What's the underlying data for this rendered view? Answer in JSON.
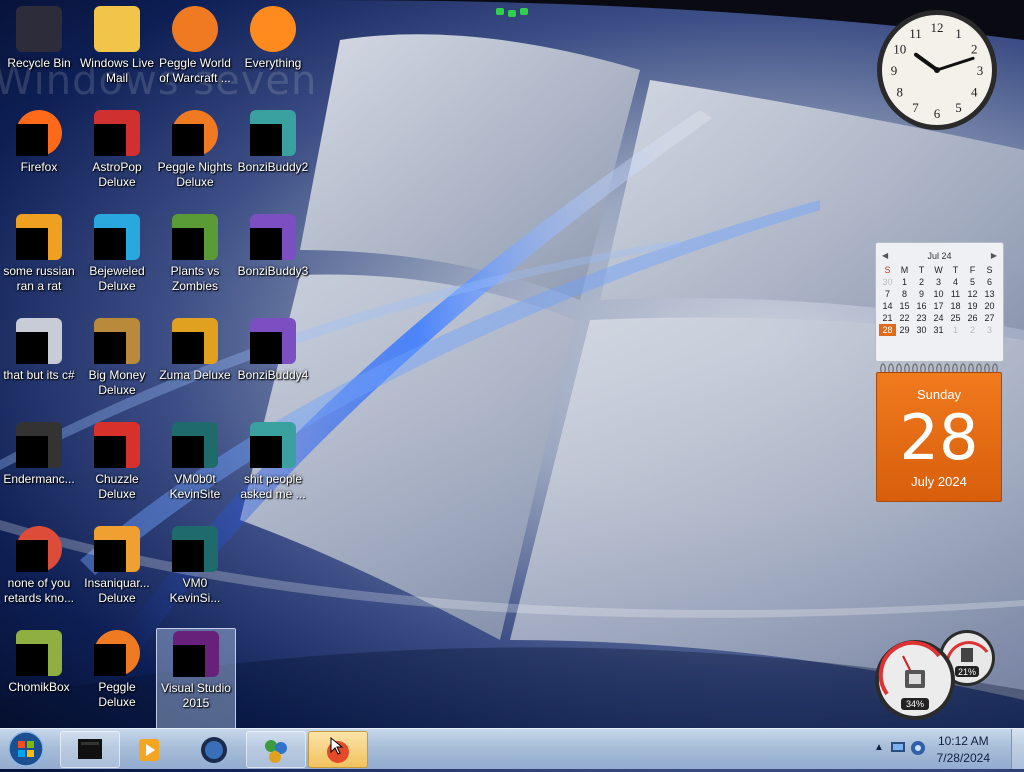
{
  "watermark": "Windows seven",
  "desktop_icons": [
    {
      "label": "Recycle Bin",
      "icon": "recycle-bin-icon"
    },
    {
      "label": "Windows Live Mail",
      "icon": "mail-icon"
    },
    {
      "label": "Peggle World of Warcraft ...",
      "icon": "peggle-icon"
    },
    {
      "label": "Everything",
      "icon": "search-icon"
    },
    {
      "label": "Firefox",
      "icon": "firefox-icon"
    },
    {
      "label": "AstroPop Deluxe",
      "icon": "game-icon"
    },
    {
      "label": "Peggle Nights Deluxe",
      "icon": "peggle-icon"
    },
    {
      "label": "BonziBuddy2",
      "icon": "folder-icon"
    },
    {
      "label": "some russian ran a rat",
      "icon": "app-icon"
    },
    {
      "label": "Bejeweled Deluxe",
      "icon": "gem-icon"
    },
    {
      "label": "Plants vs Zombies",
      "icon": "plant-icon"
    },
    {
      "label": "BonziBuddy3",
      "icon": "purple-gorilla-icon"
    },
    {
      "label": "that but its c#",
      "icon": "windows-stack-icon"
    },
    {
      "label": "Big Money Deluxe",
      "icon": "money-icon"
    },
    {
      "label": "Zuma Deluxe",
      "icon": "zuma-icon"
    },
    {
      "label": "BonziBuddy4",
      "icon": "purple-gorilla-icon"
    },
    {
      "label": "Endermanc...",
      "icon": "terminal-icon"
    },
    {
      "label": "Chuzzle Deluxe",
      "icon": "chuzzle-icon"
    },
    {
      "label": "VM0b0t KevinSite",
      "icon": "vm-icon"
    },
    {
      "label": "shit people asked me ...",
      "icon": "folder-icon"
    },
    {
      "label": "none of you retards kno...",
      "icon": "chrome-icon"
    },
    {
      "label": "Insaniquar... Deluxe",
      "icon": "fish-icon"
    },
    {
      "label": "VM0 KevinSi...",
      "icon": "vm-icon"
    },
    {
      "label": "ChomikBox",
      "icon": "hamster-icon"
    },
    {
      "label": "Peggle Deluxe",
      "icon": "peggle-icon"
    },
    {
      "label": "Visual Studio 2015",
      "icon": "visual-studio-icon"
    }
  ],
  "clock": {
    "time": "10:12"
  },
  "calendar": {
    "month_label": "Jul 24",
    "weekdays": [
      "S",
      "M",
      "T",
      "W",
      "T",
      "F",
      "S"
    ],
    "weeks": [
      [
        "30",
        "1",
        "2",
        "3",
        "4",
        "5",
        "6"
      ],
      [
        "7",
        "8",
        "9",
        "10",
        "11",
        "12",
        "13"
      ],
      [
        "14",
        "15",
        "16",
        "17",
        "18",
        "19",
        "20"
      ],
      [
        "21",
        "22",
        "23",
        "24",
        "25",
        "26",
        "27"
      ],
      [
        "28",
        "29",
        "30",
        "31",
        "1",
        "2",
        "3"
      ]
    ],
    "dow": "Sunday",
    "day": "28",
    "month_year": "July 2024",
    "accent": "#e06a1a"
  },
  "meter": {
    "cpu": "34%",
    "memory": "21%"
  },
  "taskbar": {
    "time": "10:12 AM",
    "date": "7/28/2024",
    "buttons": [
      "terminal-icon",
      "media-player-icon",
      "globe-icon",
      "messenger-icon",
      "loading-cursor-icon"
    ]
  }
}
